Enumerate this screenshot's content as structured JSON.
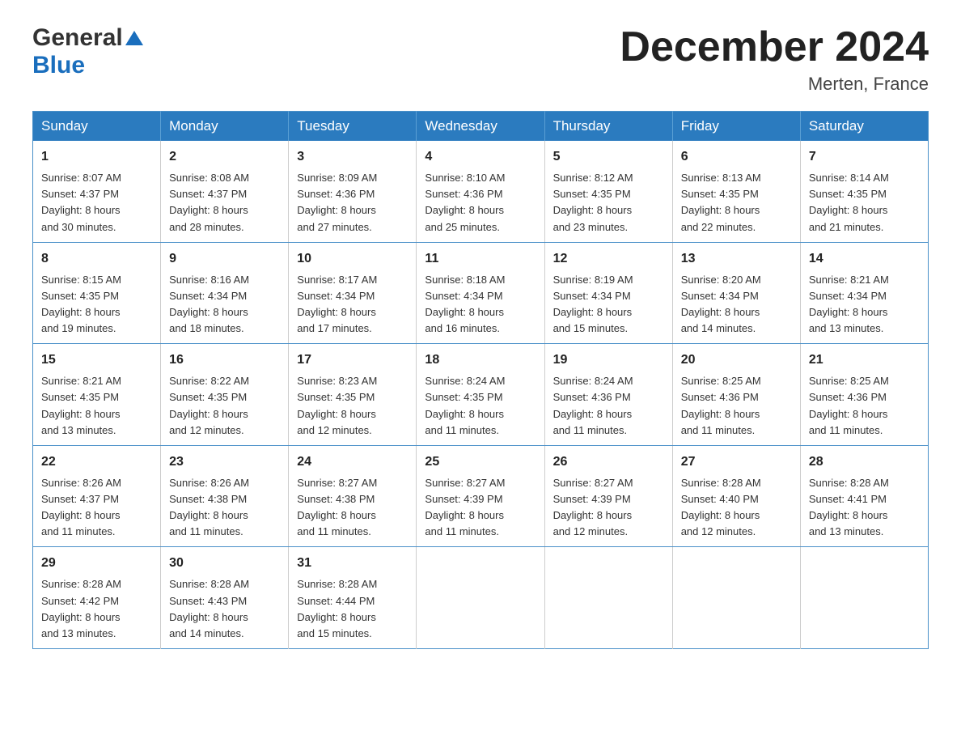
{
  "header": {
    "logo_general": "General",
    "logo_blue": "Blue",
    "month_title": "December 2024",
    "location": "Merten, France"
  },
  "weekdays": [
    "Sunday",
    "Monday",
    "Tuesday",
    "Wednesday",
    "Thursday",
    "Friday",
    "Saturday"
  ],
  "weeks": [
    [
      {
        "day": "1",
        "sunrise": "8:07 AM",
        "sunset": "4:37 PM",
        "daylight": "8 hours and 30 minutes."
      },
      {
        "day": "2",
        "sunrise": "8:08 AM",
        "sunset": "4:37 PM",
        "daylight": "8 hours and 28 minutes."
      },
      {
        "day": "3",
        "sunrise": "8:09 AM",
        "sunset": "4:36 PM",
        "daylight": "8 hours and 27 minutes."
      },
      {
        "day": "4",
        "sunrise": "8:10 AM",
        "sunset": "4:36 PM",
        "daylight": "8 hours and 25 minutes."
      },
      {
        "day": "5",
        "sunrise": "8:12 AM",
        "sunset": "4:35 PM",
        "daylight": "8 hours and 23 minutes."
      },
      {
        "day": "6",
        "sunrise": "8:13 AM",
        "sunset": "4:35 PM",
        "daylight": "8 hours and 22 minutes."
      },
      {
        "day": "7",
        "sunrise": "8:14 AM",
        "sunset": "4:35 PM",
        "daylight": "8 hours and 21 minutes."
      }
    ],
    [
      {
        "day": "8",
        "sunrise": "8:15 AM",
        "sunset": "4:35 PM",
        "daylight": "8 hours and 19 minutes."
      },
      {
        "day": "9",
        "sunrise": "8:16 AM",
        "sunset": "4:34 PM",
        "daylight": "8 hours and 18 minutes."
      },
      {
        "day": "10",
        "sunrise": "8:17 AM",
        "sunset": "4:34 PM",
        "daylight": "8 hours and 17 minutes."
      },
      {
        "day": "11",
        "sunrise": "8:18 AM",
        "sunset": "4:34 PM",
        "daylight": "8 hours and 16 minutes."
      },
      {
        "day": "12",
        "sunrise": "8:19 AM",
        "sunset": "4:34 PM",
        "daylight": "8 hours and 15 minutes."
      },
      {
        "day": "13",
        "sunrise": "8:20 AM",
        "sunset": "4:34 PM",
        "daylight": "8 hours and 14 minutes."
      },
      {
        "day": "14",
        "sunrise": "8:21 AM",
        "sunset": "4:34 PM",
        "daylight": "8 hours and 13 minutes."
      }
    ],
    [
      {
        "day": "15",
        "sunrise": "8:21 AM",
        "sunset": "4:35 PM",
        "daylight": "8 hours and 13 minutes."
      },
      {
        "day": "16",
        "sunrise": "8:22 AM",
        "sunset": "4:35 PM",
        "daylight": "8 hours and 12 minutes."
      },
      {
        "day": "17",
        "sunrise": "8:23 AM",
        "sunset": "4:35 PM",
        "daylight": "8 hours and 12 minutes."
      },
      {
        "day": "18",
        "sunrise": "8:24 AM",
        "sunset": "4:35 PM",
        "daylight": "8 hours and 11 minutes."
      },
      {
        "day": "19",
        "sunrise": "8:24 AM",
        "sunset": "4:36 PM",
        "daylight": "8 hours and 11 minutes."
      },
      {
        "day": "20",
        "sunrise": "8:25 AM",
        "sunset": "4:36 PM",
        "daylight": "8 hours and 11 minutes."
      },
      {
        "day": "21",
        "sunrise": "8:25 AM",
        "sunset": "4:36 PM",
        "daylight": "8 hours and 11 minutes."
      }
    ],
    [
      {
        "day": "22",
        "sunrise": "8:26 AM",
        "sunset": "4:37 PM",
        "daylight": "8 hours and 11 minutes."
      },
      {
        "day": "23",
        "sunrise": "8:26 AM",
        "sunset": "4:38 PM",
        "daylight": "8 hours and 11 minutes."
      },
      {
        "day": "24",
        "sunrise": "8:27 AM",
        "sunset": "4:38 PM",
        "daylight": "8 hours and 11 minutes."
      },
      {
        "day": "25",
        "sunrise": "8:27 AM",
        "sunset": "4:39 PM",
        "daylight": "8 hours and 11 minutes."
      },
      {
        "day": "26",
        "sunrise": "8:27 AM",
        "sunset": "4:39 PM",
        "daylight": "8 hours and 12 minutes."
      },
      {
        "day": "27",
        "sunrise": "8:28 AM",
        "sunset": "4:40 PM",
        "daylight": "8 hours and 12 minutes."
      },
      {
        "day": "28",
        "sunrise": "8:28 AM",
        "sunset": "4:41 PM",
        "daylight": "8 hours and 13 minutes."
      }
    ],
    [
      {
        "day": "29",
        "sunrise": "8:28 AM",
        "sunset": "4:42 PM",
        "daylight": "8 hours and 13 minutes."
      },
      {
        "day": "30",
        "sunrise": "8:28 AM",
        "sunset": "4:43 PM",
        "daylight": "8 hours and 14 minutes."
      },
      {
        "day": "31",
        "sunrise": "8:28 AM",
        "sunset": "4:44 PM",
        "daylight": "8 hours and 15 minutes."
      },
      null,
      null,
      null,
      null
    ]
  ],
  "labels": {
    "sunrise": "Sunrise:",
    "sunset": "Sunset:",
    "daylight": "Daylight:"
  }
}
